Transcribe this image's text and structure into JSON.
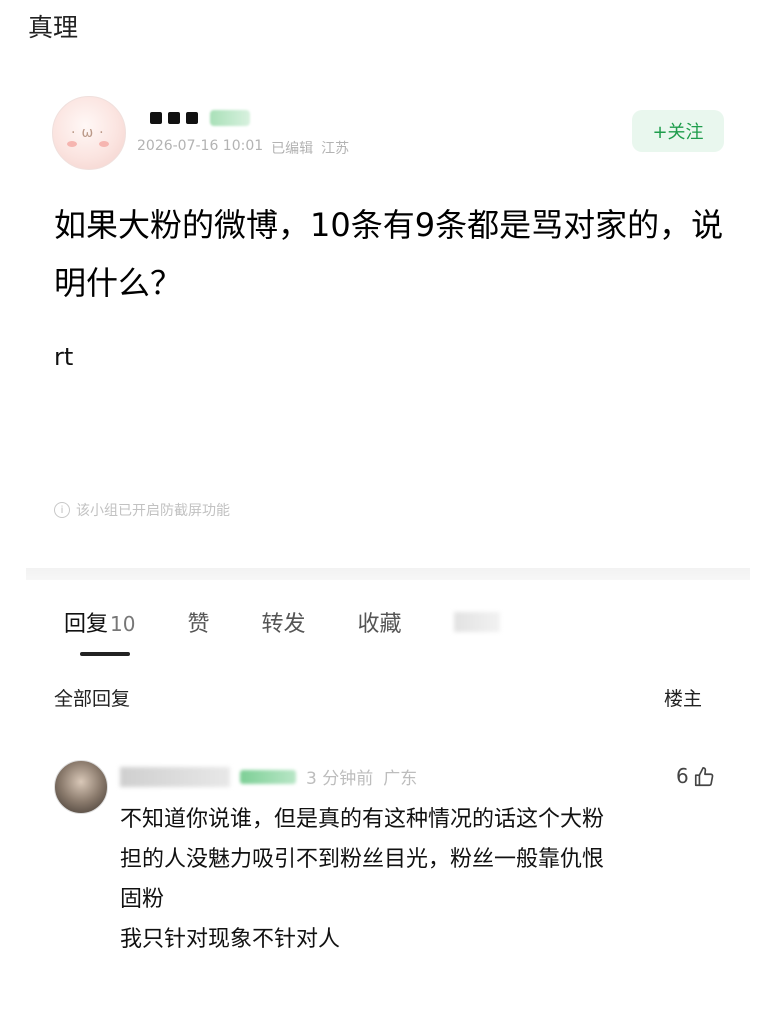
{
  "caption": "真理",
  "post": {
    "meta_date": "2026-07-16 10:01",
    "meta_edited": "已编辑",
    "meta_location": "江苏",
    "follow_label": "+关注",
    "title": "如果大粉的微博，10条有9条都是骂对家的，说明什么？",
    "body": "rt",
    "notice": "该小组已开启防截屏功能"
  },
  "tabs": [
    {
      "label": "回复",
      "count": "10"
    },
    {
      "label": "赞"
    },
    {
      "label": "转发"
    },
    {
      "label": "收藏"
    }
  ],
  "replies_header": {
    "all_label": "全部回复",
    "owner_label": "楼主"
  },
  "comment": {
    "time": "3 分钟前",
    "location": "广东",
    "likes": "6",
    "lines": [
      "不知道你说谁，但是真的有这种情况的话这个大粉",
      "担的人没魅力吸引不到粉丝目光，粉丝一般靠仇恨",
      "固粉",
      "我只针对现象不针对人"
    ]
  },
  "icons": {
    "thumb": "thumbs-up-icon",
    "info": "info-circle-icon"
  },
  "colors": {
    "accent_green": "#1f9d4c",
    "follow_bg": "#e9f7ee"
  }
}
